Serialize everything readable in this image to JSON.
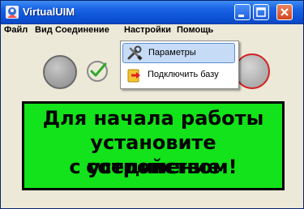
{
  "window": {
    "title": "VirtualUIM",
    "icon": "app-logo-icon",
    "controls": [
      "minimize-icon",
      "maximize-icon",
      "close-icon"
    ]
  },
  "menubar": {
    "items": [
      "Файл",
      "Вид",
      "Соединение",
      "Настройки",
      "Помощь"
    ]
  },
  "dropdown": {
    "parent": "Настройки",
    "items": [
      {
        "label": "Параметры",
        "icon": "tools-icon",
        "highlighted": true
      },
      {
        "label": "Подключить базу",
        "icon": "database-connect-icon",
        "highlighted": false
      }
    ]
  },
  "status": {
    "indicator_left": "gray-status-circle",
    "check": "check-icon",
    "indicator_right": "red-status-circle"
  },
  "message": {
    "line1": "Для начала работы",
    "line2": "установите соединение",
    "line3": "с устройством!"
  },
  "colors": {
    "panel_background": "#13e31a",
    "titlebar": "#0e54d8",
    "menu_highlight": "#c6dcf6"
  }
}
